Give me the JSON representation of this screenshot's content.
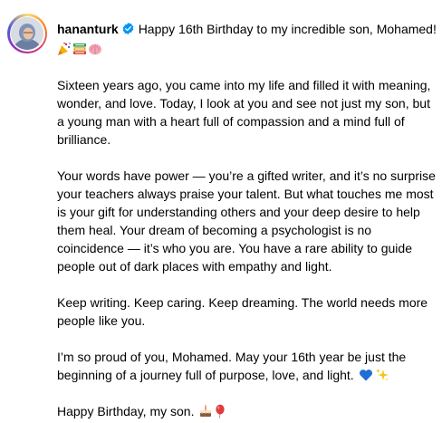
{
  "post": {
    "username": "hananturk",
    "caption_title": "Happy 16th Birthday to my incredible son, Mohamed!",
    "header_emojis": [
      "party-popper-icon",
      "books-icon",
      "brain-icon"
    ],
    "paragraphs": [
      "Sixteen years ago, you came into my life and filled it with meaning, wonder, and love. Today, I look at you and see not just my son, but a young man with a heart full of compassion and a mind full of brilliance.",
      "Your words have power — you’re a gifted writer, and it’s no surprise your teachers always praise your talent. But what touches me most is your gift for understanding others and your deep desire to help them heal. Your dream of becoming a psychologist is no coincidence — it’s who you are. You have a rare ability to guide people out of dark places with empathy and light.",
      "Keep writing. Keep caring. Keep dreaming. The world needs more people like you.",
      "I’m so proud of you, Mohamed. May your 16th year be just the beginning of a journey full of purpose, love, and light.",
      "Happy Birthday, my son."
    ],
    "colors": {
      "verified": "#0095f6",
      "text": "#000000",
      "heart": "#1f6fd6"
    }
  }
}
